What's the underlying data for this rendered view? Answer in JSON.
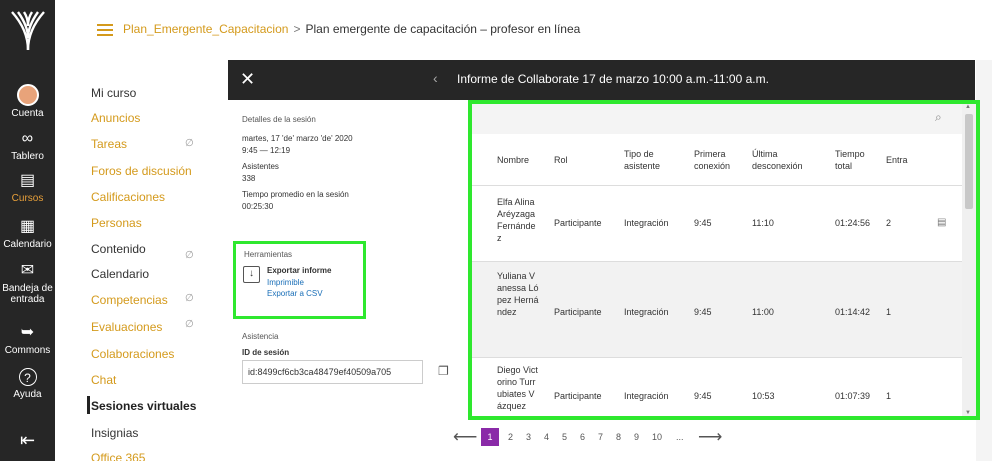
{
  "rail": {
    "items": [
      {
        "label": "Cuenta",
        "icon": "avatar-icon"
      },
      {
        "label": "Tablero",
        "icon": "dashboard-icon",
        "glyph": "∞"
      },
      {
        "label": "Cursos",
        "icon": "courses-icon",
        "glyph": "▤"
      },
      {
        "label": "Calendario",
        "icon": "calendar-icon",
        "glyph": "▦"
      },
      {
        "label": "Bandeja de entrada",
        "icon": "inbox-icon",
        "glyph": "✉"
      },
      {
        "label": "Commons",
        "icon": "commons-icon",
        "glyph": "➥"
      },
      {
        "label": "Ayuda",
        "icon": "help-icon",
        "glyph": "?"
      }
    ],
    "collapse_glyph": "⇤"
  },
  "header": {
    "course_link": "Plan_Emergente_Capacitacion",
    "separator": ">",
    "current": "Plan emergente de capacitación – profesor en línea"
  },
  "course_nav": {
    "items": [
      {
        "label": "Mi curso",
        "style": "dark"
      },
      {
        "label": "Anuncios",
        "style": "link"
      },
      {
        "label": "Tareas",
        "style": "link",
        "hidden": true
      },
      {
        "label": "Foros de discusión",
        "style": "link"
      },
      {
        "label": "Calificaciones",
        "style": "link"
      },
      {
        "label": "Personas",
        "style": "link"
      },
      {
        "label": "Contenido",
        "style": "dark",
        "hidden": true
      },
      {
        "label": "Calendario",
        "style": "dark"
      },
      {
        "label": "Competencias",
        "style": "link",
        "hidden": true
      },
      {
        "label": "Evaluaciones",
        "style": "link",
        "hidden": true
      },
      {
        "label": "Colaboraciones",
        "style": "link"
      },
      {
        "label": "Chat",
        "style": "link"
      },
      {
        "label": "Sesiones virtuales",
        "style": "active"
      },
      {
        "label": "Insignias",
        "style": "dark"
      },
      {
        "label": "Office 365",
        "style": "link"
      }
    ],
    "hidden_glyph": "∅"
  },
  "panel": {
    "title": "Informe de Collaborate 17 de marzo 10:00 a.m.-11:00 a.m.",
    "close_glyph": "✕",
    "back_glyph": "‹",
    "details": {
      "heading": "Detalles de la sesión",
      "date": "martes, 17 'de' marzo 'de' 2020",
      "time": "9:45 — 12:19",
      "attendees_label": "Asistentes",
      "attendees_value": "338",
      "avg_label": "Tiempo promedio en la sesión",
      "avg_value": "00:25:30"
    },
    "tools": {
      "heading": "Herramientas",
      "icon_glyph": "↓",
      "export_title": "Exportar informe",
      "printable": "Imprimible",
      "csv": "Exportar a CSV"
    },
    "attendance_label": "Asistencia",
    "session_id_label": "ID de sesión",
    "session_id_value": "id:8499cf6cb3ca48479ef40509a705",
    "copy_glyph": "❐"
  },
  "table": {
    "search_glyph": "⌕",
    "headers": {
      "nombre": "Nombre",
      "rol": "Rol",
      "tipo": "Tipo de asistente",
      "primera": "Primera conexión",
      "ultima": "Última desconexión",
      "tiempo": "Tiempo total",
      "entra": "Entra"
    },
    "rows": [
      {
        "nombre": "Elfa Alina Aréyzaga Fernández",
        "rol": "Participante",
        "tipo": "Integración",
        "primera": "9:45",
        "ultima": "11:10",
        "tiempo": "01:24:56",
        "entra": "2",
        "details_glyph": "▤"
      },
      {
        "nombre": "Yuliana Vanessa López Hernández",
        "rol": "Participante",
        "tipo": "Integración",
        "primera": "9:45",
        "ultima": "11:00",
        "tiempo": "01:14:42",
        "entra": "1"
      },
      {
        "nombre": "Diego Victorino Turrubiates Vázquez",
        "rol": "Participante",
        "tipo": "Integración",
        "primera": "9:45",
        "ultima": "10:53",
        "tiempo": "01:07:39",
        "entra": "1"
      }
    ]
  },
  "pagination": {
    "prev_glyph": "⟵",
    "next_glyph": "⟶",
    "pages": [
      "1",
      "2",
      "3",
      "4",
      "5",
      "6",
      "7",
      "8",
      "9",
      "10",
      "..."
    ],
    "current": "1"
  },
  "colors": {
    "rail_bg": "#262626",
    "accent": "#d49a1c",
    "highlight_box": "#2ee82e",
    "current_page": "#8a2aa8",
    "link_blue": "#1a6fb8"
  }
}
